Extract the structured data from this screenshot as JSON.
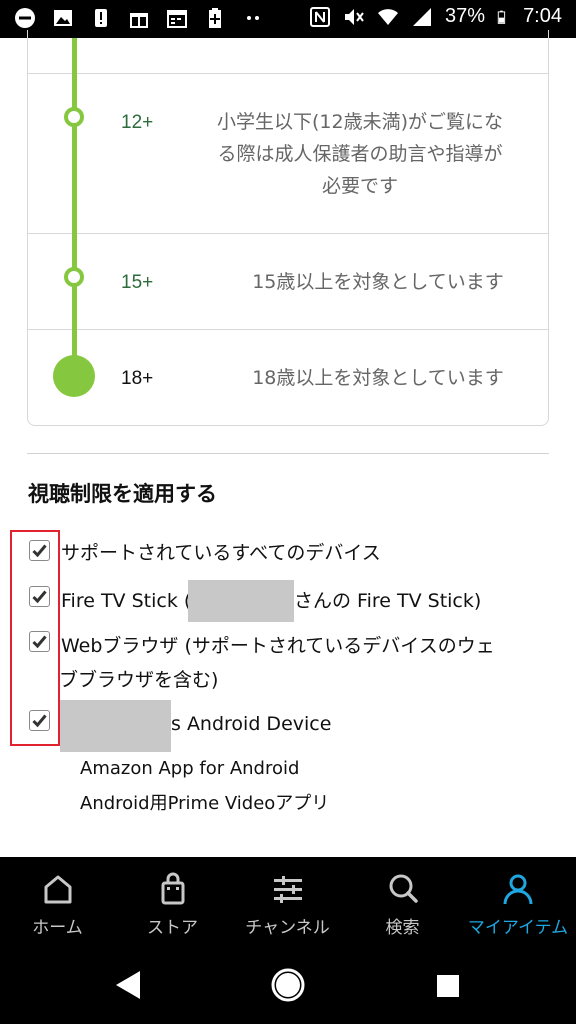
{
  "status_bar": {
    "battery_percent": "37%",
    "time": "7:04",
    "left_icons": [
      "minus-circle-icon",
      "image-icon",
      "alert-icon",
      "gift-icon",
      "calendar-icon",
      "battery-plus-icon",
      "more-dots-icon"
    ],
    "right_icons": [
      "nfc-icon",
      "mute-icon",
      "wifi-icon",
      "signal-icon",
      "battery-icon"
    ]
  },
  "ratings": [
    {
      "age": "12+",
      "description_lines": [
        "小学生以下(12歳未満)がご覧にな",
        "る際は成人保護者の助言や指導が",
        "必要です"
      ],
      "age_color": "#2e6b3c"
    },
    {
      "age": "15+",
      "description_lines": [
        "15歳以上を対象としています"
      ],
      "age_color": "#2e6b3c"
    },
    {
      "age": "18+",
      "description_lines": [
        "18歳以上を対象としています"
      ],
      "age_color": "#111111"
    }
  ],
  "restriction": {
    "title": "視聴制限を適用する",
    "devices": [
      {
        "checked": true,
        "label": "サポートされているすべてのデバイス"
      },
      {
        "checked": true,
        "label_prefix": "Fire TV Stick (",
        "label_suffix": "さんの Fire TV Stick)"
      },
      {
        "checked": true,
        "label_line1": "Webブラウザ (サポートされているデバイスのウェ",
        "label_line2": "ブブラウザを含む)"
      },
      {
        "checked": true,
        "label_suffix": "s Android Device",
        "sub_items": [
          "Amazon App for Android",
          "Android用Prime Videoアプリ"
        ]
      }
    ]
  },
  "bottom_nav": {
    "items": [
      {
        "label": "ホーム",
        "icon": "home-icon",
        "active": false
      },
      {
        "label": "ストア",
        "icon": "shopping-bag-icon",
        "active": false
      },
      {
        "label": "チャンネル",
        "icon": "channels-icon",
        "active": false
      },
      {
        "label": "検索",
        "icon": "search-icon",
        "active": false
      },
      {
        "label": "マイアイテム",
        "icon": "person-icon",
        "active": true
      }
    ],
    "active_color": "#1ea7e0",
    "inactive_color": "#c8c8c8"
  },
  "colors": {
    "timeline_green": "#86c740",
    "highlight_red": "#e0232e"
  }
}
